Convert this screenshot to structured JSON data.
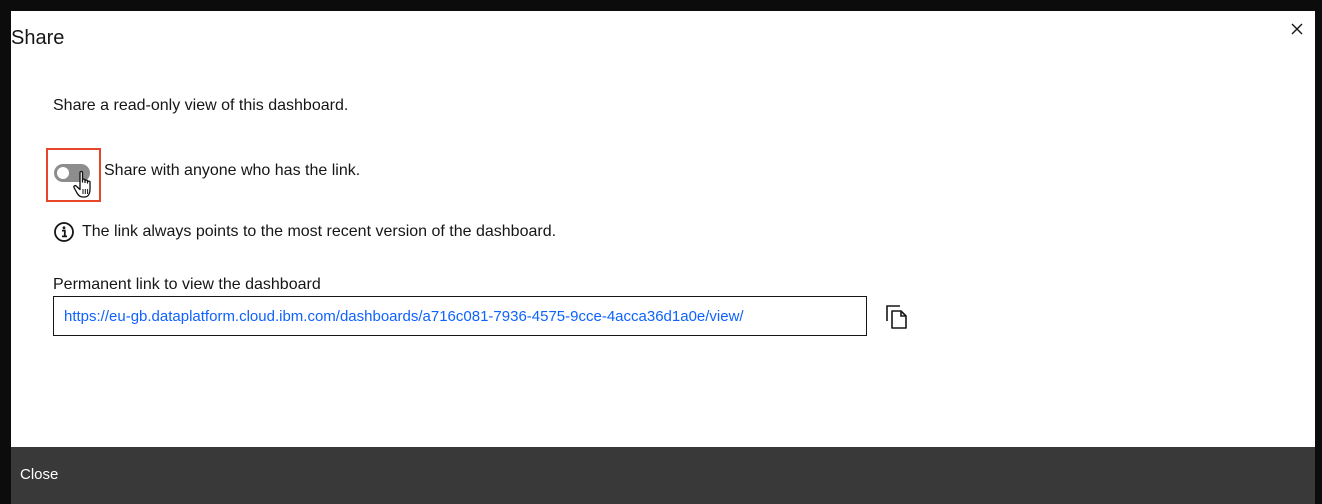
{
  "modal": {
    "title": "Share",
    "close_icon": "close-icon",
    "description": "Share a read-only view of this dashboard.",
    "toggle": {
      "label": "Share with anyone who has the link.",
      "state": "off",
      "highlight_color": "#e8462a",
      "track_color": "#8d8d8d"
    },
    "info": {
      "icon": "info-icon",
      "text": "The link always points to the most recent version of the dashboard."
    },
    "link": {
      "label": "Permanent link to view the dashboard",
      "value": "https://eu-gb.dataplatform.cloud.ibm.com/dashboards/a716c081-7936-4575-9cce-4acca36d1a0e/view/",
      "color": "#0f62fe",
      "copy_icon": "copy-icon"
    },
    "footer": {
      "close_label": "Close",
      "background": "#393939"
    }
  }
}
